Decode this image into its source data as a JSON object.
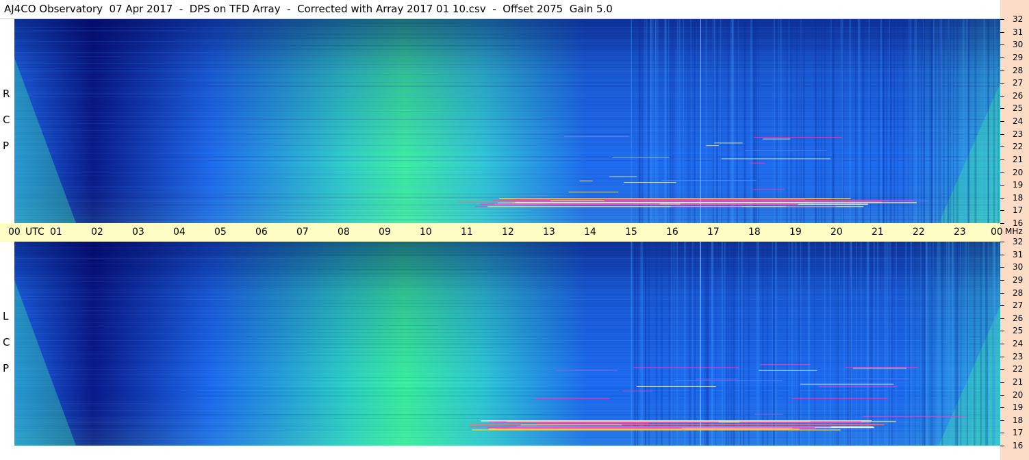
{
  "title": "AJ4CO Observatory  07 Apr 2017  -  DPS on TFD Array  -  Corrected with Array 2017 01 10.csv  -  Offset 2075  Gain 5.0",
  "colors": {
    "background": "#ffffff",
    "axis_band": "#fdfdc4",
    "right_band": "#fcdcc4",
    "low_power": "#0a1a8a",
    "mid_power": "#1e6cf0",
    "high_power": "#3cf0a0",
    "burst": "#ff3cc8"
  },
  "chart_data": {
    "type": "heatmap",
    "title": "AJ4CO Observatory  07 Apr 2017  -  DPS on TFD Array  -  Corrected with Array 2017 01 10.csv  -  Offset 2075  Gain 5.0",
    "x_axis": {
      "unit_label": "UTC",
      "range_hours": [
        0,
        24
      ],
      "tick_labels": [
        "00",
        "01",
        "02",
        "03",
        "04",
        "05",
        "06",
        "07",
        "08",
        "09",
        "10",
        "11",
        "12",
        "13",
        "14",
        "15",
        "16",
        "17",
        "18",
        "19",
        "20",
        "21",
        "22",
        "23",
        "00"
      ]
    },
    "y_axis": {
      "unit_label": "MHz",
      "range_mhz": [
        16,
        32
      ],
      "tick_labels": [
        "16",
        "17",
        "18",
        "19",
        "20",
        "21",
        "22",
        "23",
        "24",
        "25",
        "26",
        "27",
        "28",
        "29",
        "30",
        "31",
        "32"
      ]
    },
    "panels": [
      {
        "label": "RCP",
        "letters": [
          "R",
          "C",
          "P"
        ]
      },
      {
        "label": "LCP",
        "letters": [
          "L",
          "C",
          "P"
        ]
      }
    ],
    "features": {
      "daytime_peak_hour": 9.5,
      "background_rise_hours": [
        8,
        12
      ],
      "interference_band_mhz": [
        17.2,
        18.0
      ],
      "interference_hours": [
        10.8,
        22
      ],
      "night_burst_hours": [
        [
          0,
          1.5
        ],
        [
          22.5,
          24
        ]
      ],
      "vertical_line_hour": 16.7
    }
  }
}
